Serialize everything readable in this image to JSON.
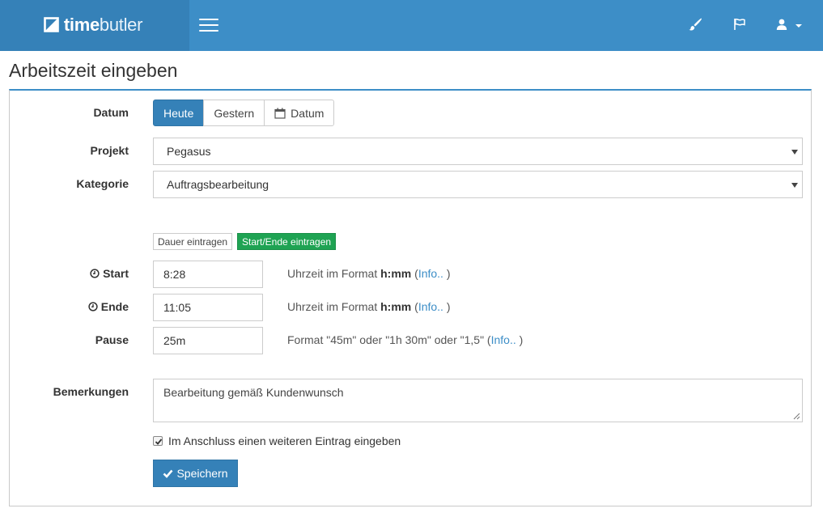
{
  "navbar": {
    "brand_bold": "time",
    "brand_light": "butler",
    "icons": [
      "logo-icon",
      "hamburger-icon",
      "paintbrush-icon",
      "flag-icon",
      "user-icon",
      "caret-down-icon"
    ]
  },
  "page": {
    "title": "Arbeitszeit eingeben"
  },
  "form": {
    "datum_label": "Datum",
    "datum_buttons": [
      "Heute",
      "Gestern",
      "Datum"
    ],
    "datum_active": "Heute",
    "projekt_label": "Projekt",
    "projekt_value": "Pegasus",
    "kategorie_label": "Kategorie",
    "kategorie_value": "Auftragsbearbeitung",
    "mode_duration": "Dauer eintragen",
    "mode_startend": "Start/Ende eintragen",
    "start_label": "Start",
    "start_value": "8:28",
    "ende_label": "Ende",
    "ende_value": "11:05",
    "pause_label": "Pause",
    "pause_value": "25m",
    "help_time_prefix": "Uhrzeit im Format ",
    "help_time_format": "h:mm",
    "help_info_link": "Info..",
    "help_pause_text": "Format \"45m\" oder \"1h 30m\" oder \"1,5\"",
    "paren_open": " (",
    "paren_close": " )",
    "bemerkungen_label": "Bemerkungen",
    "bemerkungen_value": "Bearbeitung gemäß Kundenwunsch",
    "checkbox_label": "Im Anschluss einen weiteren Eintrag eingeben",
    "checkbox_checked": true,
    "save_label": "Speichern"
  },
  "colors": {
    "navbar": "#3d8ec7",
    "brand_bg": "#3581b8",
    "primary": "#3581b8",
    "success": "#1fa353",
    "link": "#3d8ec7"
  }
}
